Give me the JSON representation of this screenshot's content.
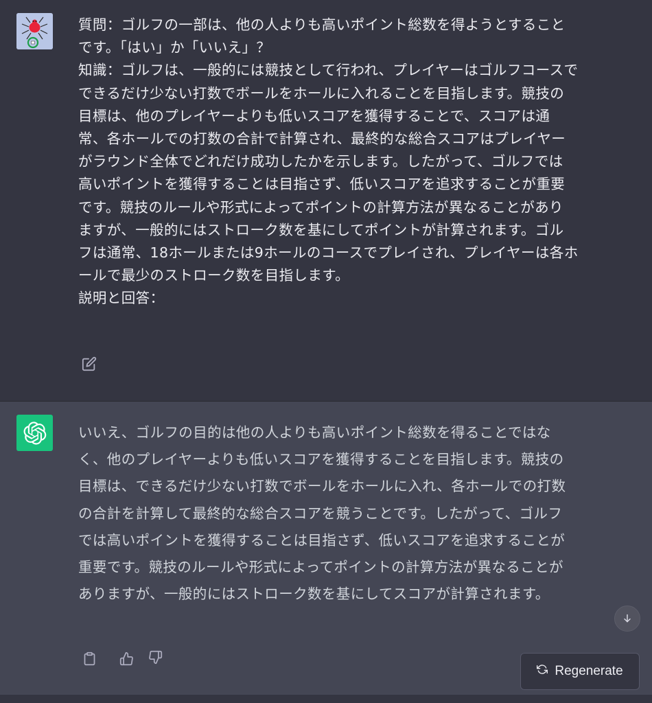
{
  "user_message": {
    "avatar_icon": "spider-avatar-icon",
    "text": "質問：ゴルフの一部は、他の人よりも高いポイント総数を得ようとすること\nです。「はい」か「いいえ」？\n知識：ゴルフは、一般的には競技として行われ、プレイヤーはゴルフコースで\nできるだけ少ない打数でボールをホールに入れることを目指します。競技の\n目標は、他のプレイヤーよりも低いスコアを獲得することで、スコアは通\n常、各ホールでの打数の合計で計算され、最終的な総合スコアはプレイヤー\nがラウンド全体でどれだけ成功したかを示します。したがって、ゴルフでは\n高いポイントを獲得することは目指さず、低いスコアを追求することが重要\nです。競技のルールや形式によってポイントの計算方法が異なることがあり\nますが、一般的にはストローク数を基にしてポイントが計算されます。ゴル\nフは通常、18ホールまたは9ホールのコースでプレイされ、プレイヤーは各ホ\nールで最少のストローク数を目指します。\n説明と回答：",
    "edit_icon": "edit-icon"
  },
  "assistant_message": {
    "avatar_icon": "openai-logo-icon",
    "text": "いいえ、ゴルフの目的は他の人よりも高いポイント総数を得ることではな\nく、他のプレイヤーよりも低いスコアを獲得することを目指します。競技の\n目標は、できるだけ少ない打数でボールをホールに入れ、各ホールでの打数\nの合計を計算して最終的な総合スコアを競うことです。したがって、ゴルフ\nでは高いポイントを獲得することは目指さず、低いスコアを追求することが\n重要です。競技のルールや形式によってポイントの計算方法が異なることが\nありますが、一般的にはストローク数を基にしてスコアが計算されます。",
    "actions": [
      "clipboard-icon",
      "thumbs-up-icon",
      "thumbs-down-icon"
    ]
  },
  "controls": {
    "regenerate_label": "Regenerate",
    "regenerate_icon": "refresh-icon",
    "scroll_icon": "arrow-down-icon"
  },
  "colors": {
    "user_bg": "#343541",
    "assistant_bg": "#444654",
    "gpt_accent": "#19c37d"
  }
}
